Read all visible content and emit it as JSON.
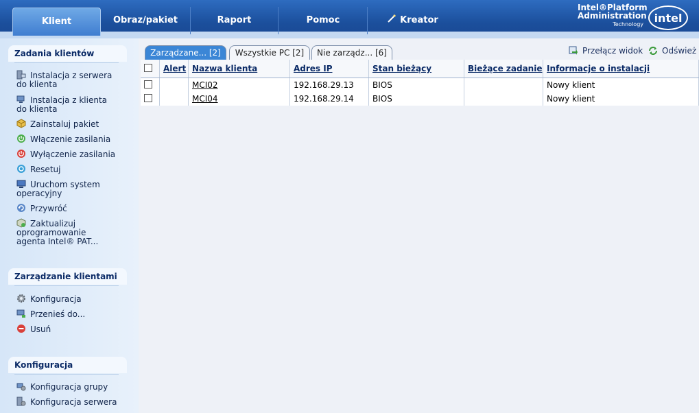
{
  "nav": {
    "tabs": [
      {
        "label": "Klient"
      },
      {
        "label": "Obraz/pakiet"
      },
      {
        "label": "Raport"
      },
      {
        "label": "Pomoc"
      },
      {
        "label": "Kreator"
      }
    ],
    "brand": {
      "line1": "Intel®Platform",
      "line2": "Administration",
      "line3": "Technology",
      "logo": "intel"
    }
  },
  "sidebar": {
    "tasks": {
      "title": "Zadania klientów",
      "items": [
        {
          "label": "Instalacja z serwera do klienta",
          "icon": "server-install-icon"
        },
        {
          "label": "Instalacja z klienta do klienta",
          "icon": "client-install-icon"
        },
        {
          "label": "Zainstaluj pakiet",
          "icon": "package-icon"
        },
        {
          "label": "Włączenie zasilania",
          "icon": "power-on-icon"
        },
        {
          "label": "Wyłączenie zasilania",
          "icon": "power-off-icon"
        },
        {
          "label": "Resetuj",
          "icon": "reset-icon"
        },
        {
          "label": "Uruchom system operacyjny",
          "icon": "boot-os-icon"
        },
        {
          "label": "Przywróć",
          "icon": "restore-icon"
        },
        {
          "label": "Zaktualizuj oprogramowanie agenta Intel® PAT...",
          "icon": "update-agent-icon"
        }
      ]
    },
    "management": {
      "title": "Zarządzanie klientami",
      "items": [
        {
          "label": "Konfiguracja",
          "icon": "gear-icon"
        },
        {
          "label": "Przenieś do...",
          "icon": "move-icon"
        },
        {
          "label": "Usuń",
          "icon": "delete-icon"
        }
      ]
    },
    "config": {
      "title": "Konfiguracja",
      "items": [
        {
          "label": "Konfiguracja grupy",
          "icon": "group-config-icon"
        },
        {
          "label": "Konfiguracja serwera",
          "icon": "server-config-icon"
        }
      ]
    }
  },
  "main": {
    "tabs": [
      {
        "label": "Zarządzane... [2]"
      },
      {
        "label": "Wszystkie PC [2]"
      },
      {
        "label": "Nie zarządz... [6]"
      }
    ],
    "toolbar": {
      "switch_view": "Przełącz widok",
      "refresh": "Odśwież"
    },
    "table": {
      "headers": [
        "Alert",
        "Nazwa klienta",
        "Adres IP",
        "Stan bieżący",
        "Bieżące zadanie",
        "Informacje o instalacji"
      ],
      "rows": [
        {
          "alert": "",
          "name": "MCI02",
          "ip": "192.168.29.13",
          "state": "BIOS",
          "task": "",
          "info": "Nowy klient"
        },
        {
          "alert": "",
          "name": "MCI04",
          "ip": "192.168.29.14",
          "state": "BIOS",
          "task": "",
          "info": "Nowy klient"
        }
      ]
    }
  },
  "colors": {
    "topbar": "#1b4f9c",
    "active_tab": "#3b86d6",
    "sidebar": "#d6e6f8",
    "panel_title": "#0a2a66"
  }
}
